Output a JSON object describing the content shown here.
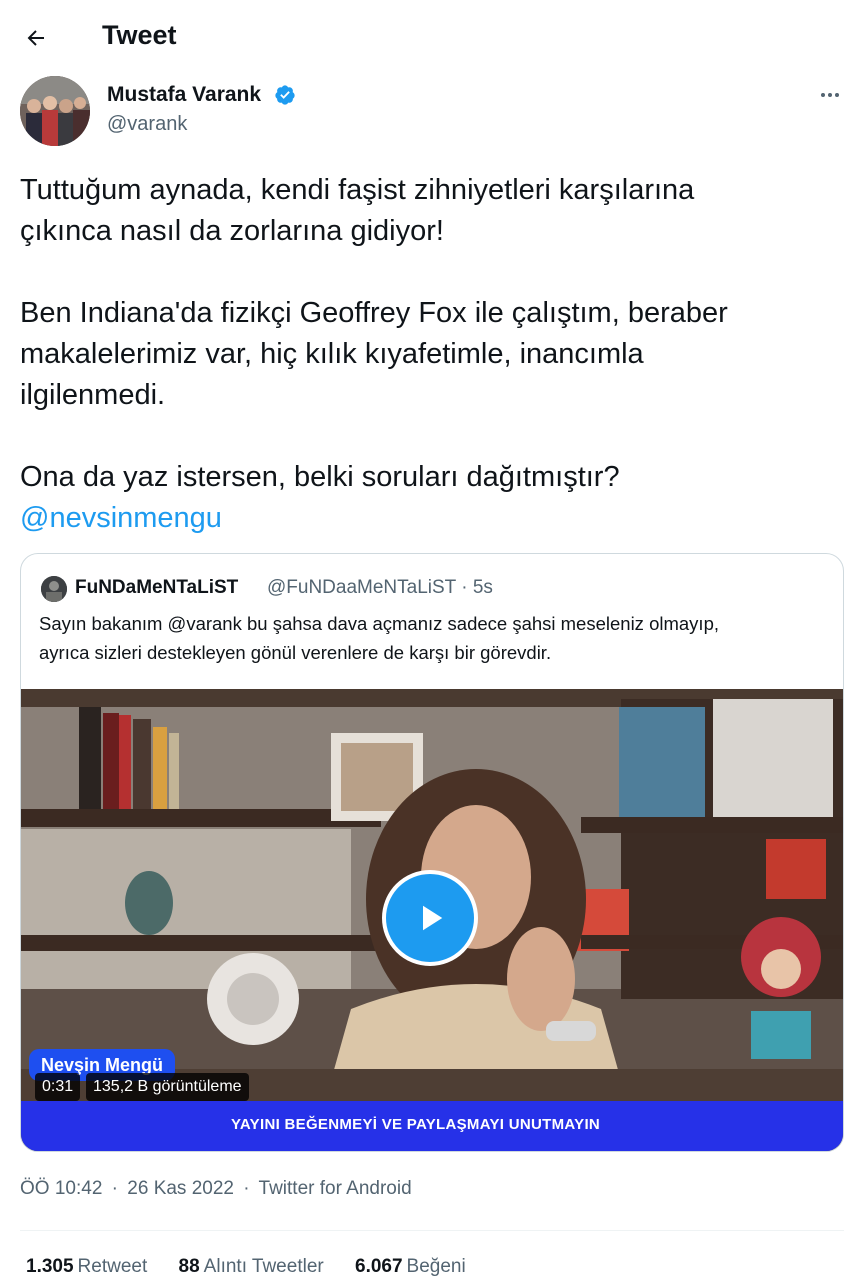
{
  "header": {
    "title": "Tweet",
    "back_icon": "arrow-left-icon"
  },
  "author": {
    "name": "Mustafa Varank",
    "handle": "@varank",
    "verified_icon": "verified-badge-icon",
    "more_icon": "more-horizontal-icon"
  },
  "tweet": {
    "line1": "Tuttuğum aynada, kendi faşist zihniyetleri karşılarına",
    "line2": "çıkınca nasıl da zorlarına gidiyor!",
    "line3": "Ben Indiana'da fizikçi Geoffrey Fox ile çalıştım, beraber",
    "line4": "makalelerimiz var, hiç kılık kıyafetimle, inancımla",
    "line5": "ilgilenmedi.",
    "line6": "Ona da yaz istersen, belki soruları dağıtmıştır?",
    "mention": "@nevsinmengu"
  },
  "quote": {
    "name": "FuNDaMeNTaLiST",
    "handle_time": "@FuNDaaMeNTaLiST · 5s",
    "text_line1": "Sayın bakanım @varank bu şahsa dava açmanız sadece şahsi meseleniz olmayıp,",
    "text_line2": "ayrıca sizleri destekleyen gönül verenlere de karşı bir görevdir.",
    "video": {
      "name_tag": "Nevşin Mengü",
      "duration": "0:31",
      "views": "135,2 B görüntüleme",
      "banner": "YAYINI BEĞENMEYİ VE PAYLAŞMAYI UNUTMAYIN",
      "play_icon": "play-icon"
    }
  },
  "meta": {
    "time": "ÖÖ 10:42",
    "date": "26 Kas 2022",
    "client": "Twitter for Android",
    "separator": "·"
  },
  "stats": {
    "retweets_count": "1.305",
    "retweets_label": "Retweet",
    "quotes_count": "88",
    "quotes_label": "Alıntı Tweetler",
    "likes_count": "6.067",
    "likes_label": "Beğeni"
  },
  "colors": {
    "accent": "#1d9bf0",
    "banner": "#2631e8",
    "text": "#0f1419",
    "muted": "#536471"
  }
}
